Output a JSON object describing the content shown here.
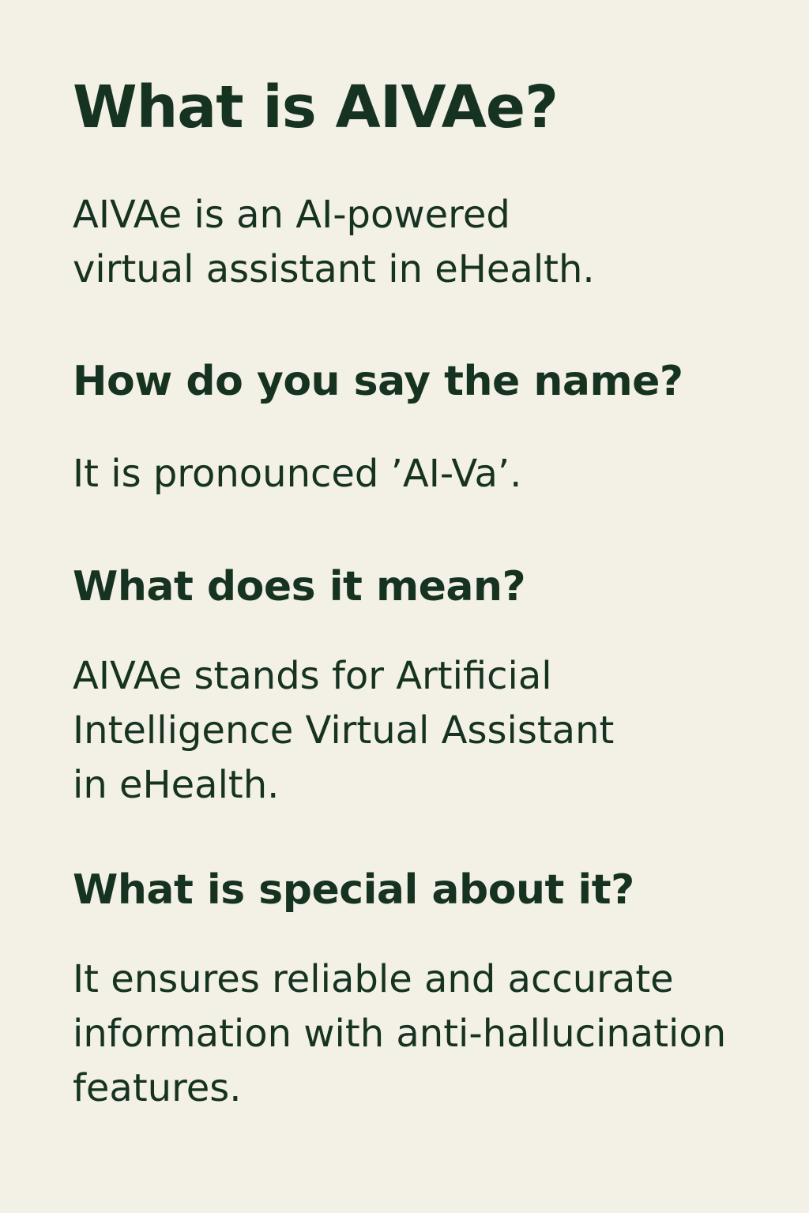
{
  "sections": [
    {
      "question": "What is AIVAe?",
      "answer_lines": [
        "AIVAe is an AI-powered",
        "virtual assistant in eHealth."
      ]
    },
    {
      "question": "How do you say the name?",
      "answer_lines": [
        "It is pronounced ’AI-Va’."
      ]
    },
    {
      "question": "What does it mean?",
      "answer_lines": [
        "AIVAe stands for Artificial",
        "Intelligence Virtual Assistant",
        "in eHealth."
      ]
    },
    {
      "question": "What is special about it?",
      "answer_lines": [
        "It ensures reliable and accurate",
        "information with anti-hallucination",
        "features."
      ]
    }
  ],
  "colors": {
    "background": "#f3f0e6",
    "text": "#163321"
  }
}
